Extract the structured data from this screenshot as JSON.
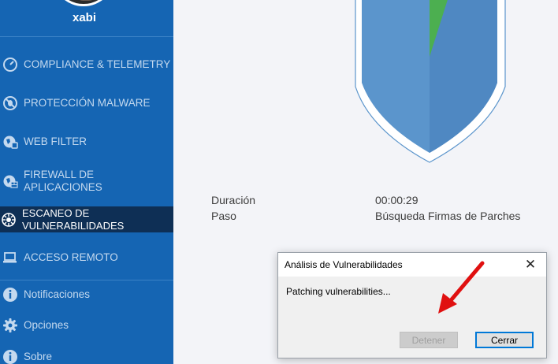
{
  "sidebar": {
    "username": "xabi",
    "items": [
      {
        "label": "COMPLIANCE & TELEMETRY",
        "icon": "gauge-icon"
      },
      {
        "label": "PROTECCIÓN MALWARE",
        "icon": "no-bug-icon"
      },
      {
        "label": "WEB FILTER",
        "icon": "globe-filter-icon"
      },
      {
        "label": "FIREWALL DE APLICACIONES",
        "icon": "globe-firewall-icon"
      },
      {
        "label": "ESCANEO DE VULNERABILIDADES",
        "icon": "vulnerability-scan-icon"
      },
      {
        "label": "ACCESO REMOTO",
        "icon": "laptop-remote-icon"
      },
      {
        "label": "Notificaciones",
        "icon": "info-icon"
      },
      {
        "label": "Opciones",
        "icon": "gear-icon"
      },
      {
        "label": "Sobre",
        "icon": "info-icon"
      }
    ]
  },
  "main": {
    "duration_label": "Duración",
    "duration_value": "00:00:29",
    "step_label": "Paso",
    "step_value": "Búsqueda Firmas de Parches"
  },
  "dialog": {
    "title": "Análisis de Vulnerabilidades",
    "message": "Patching vulnerabilities...",
    "stop_label": "Detener",
    "close_label": "Cerrar",
    "close_glyph": "✕"
  },
  "colors": {
    "sidebar": "#1565b3",
    "sidebar_active": "#0e2f55",
    "shield": "#5b95cc",
    "shield_progress": "#4caf50",
    "arrow": "#e01010"
  }
}
